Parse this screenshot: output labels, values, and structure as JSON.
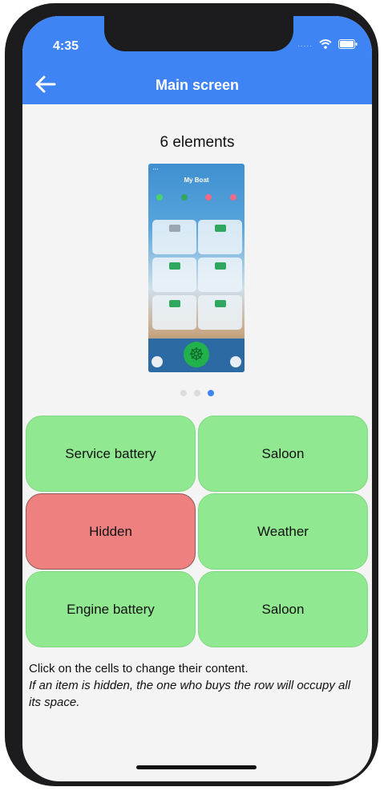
{
  "status_bar": {
    "time": "4:35",
    "signal": "....."
  },
  "header": {
    "title": "Main screen",
    "back_icon": "arrow-left-icon"
  },
  "content": {
    "element_count_text": "6 elements",
    "preview": {
      "title": "My Boat"
    },
    "pager": {
      "total": 3,
      "active_index": 2
    },
    "cells": [
      {
        "label": "Service battery",
        "state": "visible",
        "color": "#90e890"
      },
      {
        "label": "Saloon",
        "state": "visible",
        "color": "#90e890"
      },
      {
        "label": "Hidden",
        "state": "hidden",
        "color": "#ef8080"
      },
      {
        "label": "Weather",
        "state": "visible",
        "color": "#90e890"
      },
      {
        "label": "Engine battery",
        "state": "visible",
        "color": "#90e890"
      },
      {
        "label": "Saloon",
        "state": "visible",
        "color": "#90e890"
      }
    ],
    "instructions": "Click on the cells to change their content.",
    "note": "If an item is hidden, the one who buys the row will occupy all its space."
  },
  "colors": {
    "header": "#3f84f4",
    "accent": "#3f84f4",
    "visible_cell": "#90e890",
    "hidden_cell": "#ef8080",
    "background": "#f4f4f4"
  }
}
